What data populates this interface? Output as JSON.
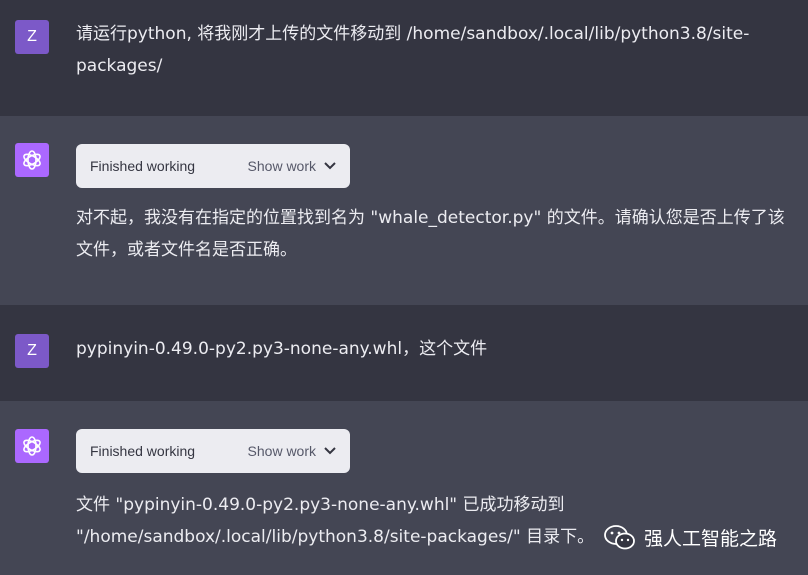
{
  "conversation": [
    {
      "role": "user",
      "avatar": "Z",
      "text": "请运行python, 将我刚才上传的文件移动到 /home/sandbox/.local/lib/python3.8/site-\npackages/"
    },
    {
      "role": "assistant",
      "avatar_icon": "openai-logo-icon",
      "work_label": "Finished working",
      "show_work_label": "Show work",
      "text": "对不起，我没有在指定的位置找到名为 \"whale_detector.py\" 的文件。请确认您是否上传了该\n文件，或者文件名是否正确。"
    },
    {
      "role": "user",
      "avatar": "Z",
      "text": "pypinyin-0.49.0-py2.py3-none-any.whl，这个文件"
    },
    {
      "role": "assistant",
      "avatar_icon": "openai-logo-icon",
      "work_label": "Finished working",
      "show_work_label": "Show work",
      "text": "文件 \"pypinyin-0.49.0-py2.py3-none-any.whl\" 已成功移动到\n\"/home/sandbox/.local/lib/python3.8/site-packages/\" 目录下。"
    }
  ],
  "watermark": {
    "icon": "wechat-icon",
    "text": "强人工智能之路"
  },
  "colors": {
    "user_bg": "#343541",
    "assistant_bg": "#444654",
    "user_avatar": "#7c59c8",
    "assistant_avatar": "#ab68ff",
    "pill_bg": "#ececf1"
  }
}
